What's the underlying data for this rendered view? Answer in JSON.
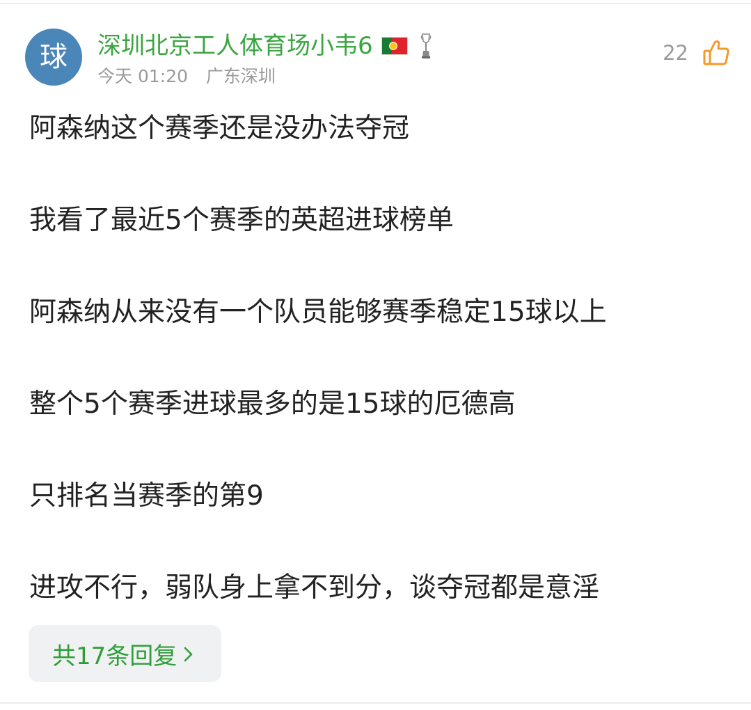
{
  "comment": {
    "avatar_text": "球",
    "username": "深圳北京工人体育场小韦6",
    "badges": {
      "flag": "portugal-flag-icon",
      "trophy": "trophy-icon"
    },
    "meta": {
      "date": "今天",
      "time": "01:20",
      "location": "广东深圳"
    },
    "likes": {
      "count": "22",
      "icon": "thumbs-up-icon",
      "color": "#f39a2b"
    },
    "lines": [
      "阿森纳这个赛季还是没办法夺冠",
      "我看了最近5个赛季的英超进球榜单",
      "阿森纳从来没有一个队员能够赛季稳定15球以上",
      "整个5个赛季进球最多的是15球的厄德高",
      "只排名当赛季的第9",
      "进攻不行，弱队身上拿不到分，谈夺冠都是意淫"
    ],
    "replies_label": "共17条回复"
  },
  "colors": {
    "username": "#3aa53f",
    "avatar_bg": "#4a86b8",
    "meta_text": "#9a9a9a",
    "body_text": "#222222",
    "reply_text": "#2f9e3a",
    "reply_bg": "#f0f1f2"
  }
}
